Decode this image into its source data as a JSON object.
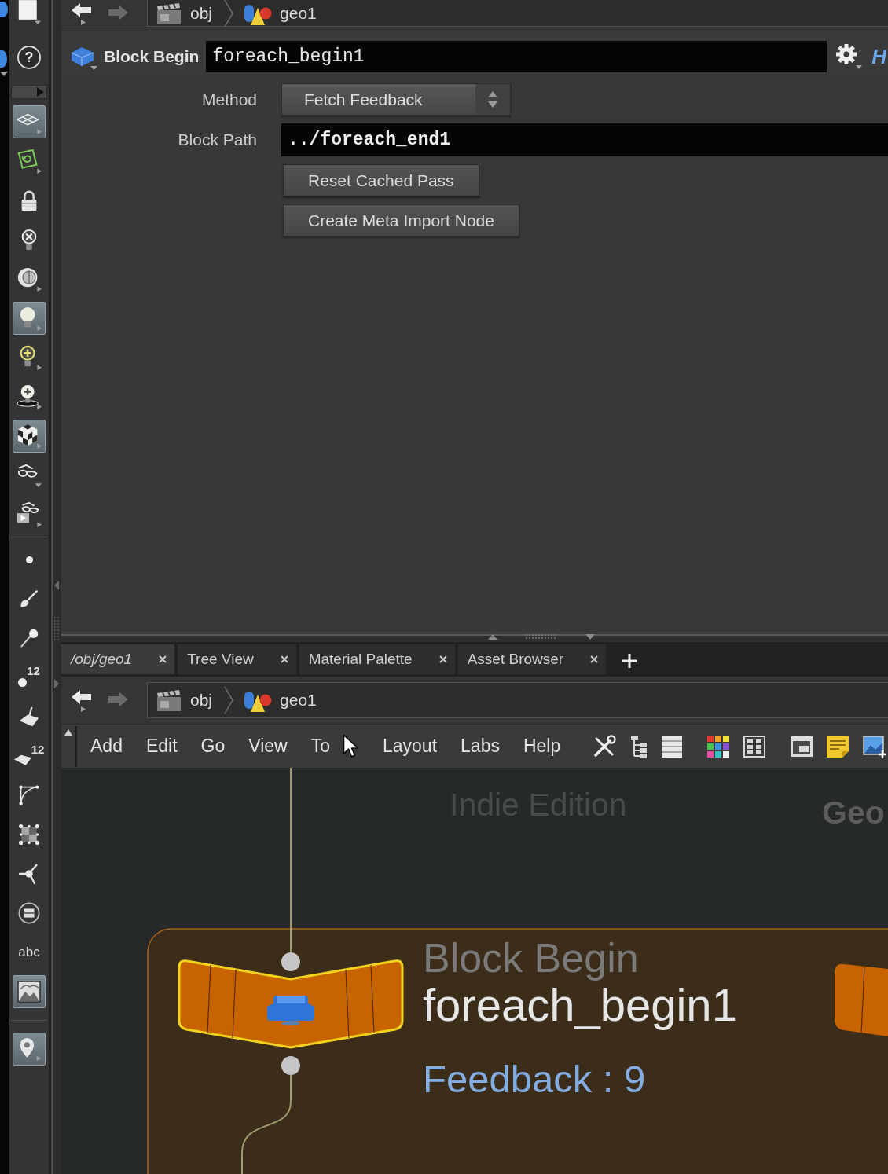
{
  "shelf": {
    "help_glyph": "?",
    "groups": [
      {
        "tools": [
          {
            "on": true
          },
          {
            "on": false
          },
          {
            "on": false
          },
          {
            "on": false
          },
          {
            "on": false
          },
          {
            "on": true
          },
          {
            "on": false
          },
          {
            "on": false
          },
          {
            "on": true
          },
          {
            "on": false
          },
          {
            "on": false
          }
        ]
      },
      {
        "tools": [
          {
            "on": false
          },
          {
            "on": false
          },
          {
            "on": false
          },
          {
            "label": "12",
            "on": false
          },
          {
            "on": false
          },
          {
            "label": "12",
            "on": false
          },
          {
            "on": false
          },
          {
            "on": false
          },
          {
            "on": false
          },
          {
            "on": false
          },
          {
            "label": "abc",
            "on": false
          },
          {
            "on": true
          }
        ]
      },
      {
        "tools": [
          {
            "on": true
          }
        ]
      }
    ]
  },
  "parameter_pane": {
    "path_bar": {
      "back_disabled": false,
      "forward_disabled": true,
      "crumbs": [
        {
          "label": "obj"
        },
        {
          "label": "geo1"
        }
      ]
    },
    "header": {
      "node_type": "Block Begin",
      "node_name": "foreach_begin1",
      "help_glyph": "H"
    },
    "parameters": [
      {
        "kind": "menu",
        "label": "Method",
        "value": "Fetch Feedback"
      },
      {
        "kind": "field",
        "label": "Block Path",
        "value": "../foreach_end1"
      },
      {
        "kind": "button",
        "label": "Reset Cached Pass"
      },
      {
        "kind": "button",
        "label": "Create Meta Import Node"
      }
    ]
  },
  "network_pane": {
    "tabs": [
      {
        "label": "/obj/geo1",
        "selected": true
      },
      {
        "label": "Tree View",
        "selected": false
      },
      {
        "label": "Material Palette",
        "selected": false
      },
      {
        "label": "Asset Browser",
        "selected": false
      }
    ],
    "path_bar": {
      "back_disabled": false,
      "forward_disabled": true,
      "crumbs": [
        {
          "label": "obj"
        },
        {
          "label": "geo1"
        }
      ]
    },
    "menu": [
      "Add",
      "Edit",
      "Go",
      "View",
      "To",
      "Layout",
      "Labs",
      "Help"
    ],
    "canvas": {
      "edition_label": "Indie Edition",
      "context_label": "Geo",
      "node": {
        "type": "Block Begin",
        "name": "foreach_begin1",
        "info": "Feedback : 9",
        "selected": true
      }
    }
  }
}
